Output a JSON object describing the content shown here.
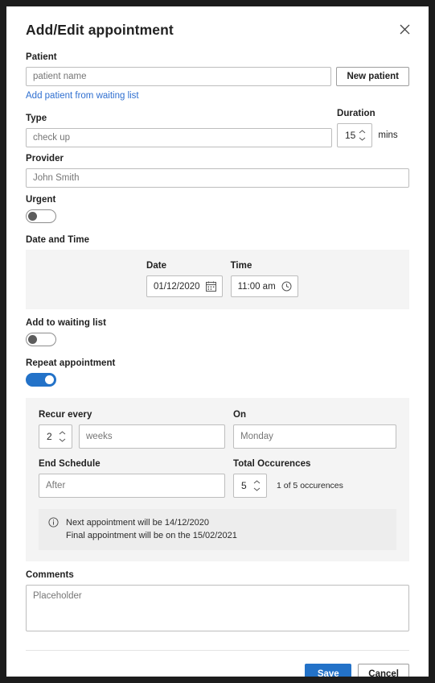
{
  "dialog": {
    "title": "Add/Edit appointment",
    "close_icon": "close-icon"
  },
  "patient": {
    "label": "Patient",
    "placeholder": "patient name",
    "value": "",
    "new_patient_button": "New patient",
    "waiting_list_link": "Add patient from waiting list"
  },
  "type": {
    "label": "Type",
    "placeholder": "check up",
    "value": ""
  },
  "duration": {
    "label": "Duration",
    "value": "15",
    "unit": "mins"
  },
  "provider": {
    "label": "Provider",
    "placeholder": "John Smith",
    "value": ""
  },
  "urgent": {
    "label": "Urgent",
    "state": "off"
  },
  "date_and_time": {
    "label": "Date and Time",
    "date": {
      "label": "Date",
      "value": "01/12/2020",
      "icon": "calendar-icon"
    },
    "time": {
      "label": "Time",
      "value": "11:00 am",
      "icon": "clock-icon"
    }
  },
  "waiting_list": {
    "label": "Add to waiting list",
    "state": "off"
  },
  "repeat": {
    "label": "Repeat appointment",
    "state": "on"
  },
  "recurrence": {
    "recur_every": {
      "label": "Recur every",
      "count": "2",
      "unit_placeholder": "weeks",
      "unit_value": ""
    },
    "on": {
      "label": "On",
      "placeholder": "Monday",
      "value": ""
    },
    "end_schedule": {
      "label": "End Schedule",
      "placeholder": "After",
      "value": ""
    },
    "total_occurrences": {
      "label": "Total Occurences",
      "value": "5",
      "note": "1 of 5 occurences"
    },
    "info": {
      "icon": "info-icon",
      "line1": "Next appointment will be 14/12/2020",
      "line2": "Final appointment will be on the 15/02/2021"
    }
  },
  "comments": {
    "label": "Comments",
    "placeholder": "Placeholder",
    "value": ""
  },
  "footer": {
    "save_label": "Save",
    "cancel_label": "Cancel"
  },
  "colors": {
    "accent": "#2372c8",
    "link": "#2f6fd0",
    "panel_bg": "#f4f4f4",
    "info_bg": "#ededed",
    "border": "#bdbdbd"
  }
}
